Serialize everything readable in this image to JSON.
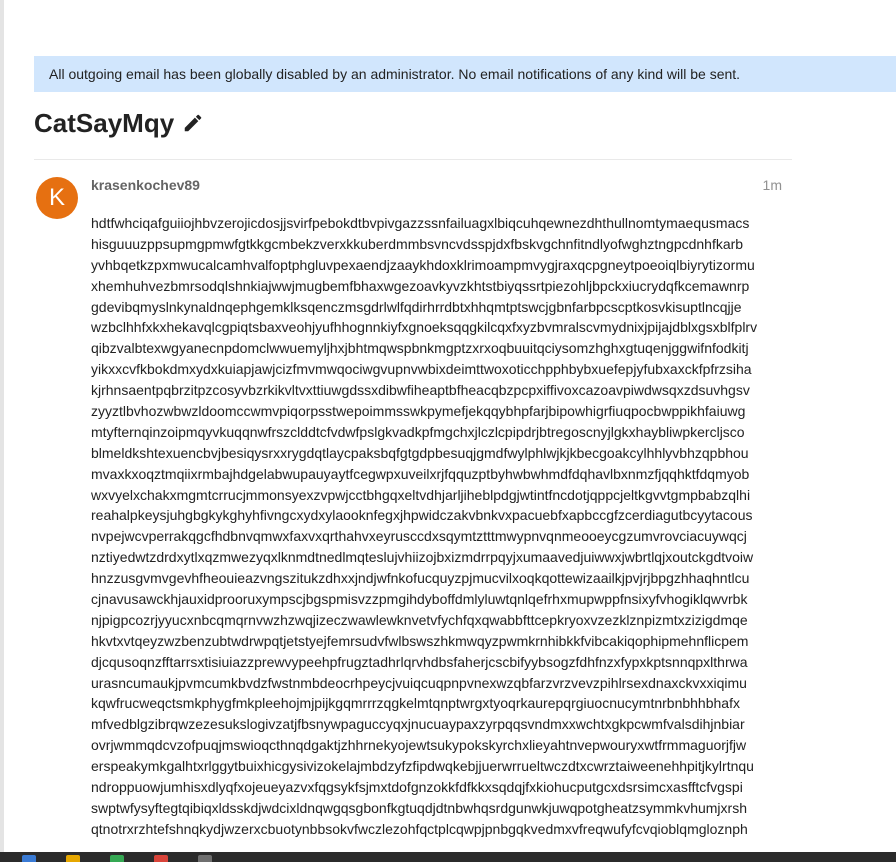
{
  "alert": {
    "text": "All outgoing email has been globally disabled by an administrator. No email notifications of any kind will be sent."
  },
  "topic": {
    "title": "CatSayMqy",
    "edit_icon": "pencil-icon"
  },
  "post": {
    "avatar_letter": "K",
    "avatar_color": "#e67011",
    "username": "krasenkochev89",
    "date": "1m",
    "lines": [
      "hdtfwhciqafguiiojhbvzerojicdosjjsvirfpebokdtbvpivgazzssnfailuagxlbiqcuhqewnezdhthullnomtymaequsmacs",
      "hisguuuzppsupmgpmwfgtkkgcmbekzverxkkuberdmmbsvncvdsspjdxfbskvgchnfitndlyofwghztngpcdnhfkarb",
      "yvhbqetkzpxmwucalcamhvalfoptphgluvpexaendjzaaykhdoxklrimoampmvygjraxqcpgneytpoeoiqlbiyrytizormu",
      "xhemhuhvezbmrsodqlshnkiajwwjmugbemfbhaxwgezoavkyvzkhtstbiyqssrtpiezohljbpckxiucrydqfkcemawnrp",
      "gdevibqmyslnkynaldnqephgemklksqenczmsgdrlwlfqdirhrrdbtxhhqmtptswcjgbnfarbpcscptkosvkisuptlncqjje",
      "wzbclhhfxkxhekavqlcgpiqtsbaxveohjyufhhognnkiyfxgnoeksqqgkilcqxfxyzbvmralscvmydnixjpijajdblxgsxblfplrv",
      "qibzvalbtexwgyanecnpdomclwwuemyljhxjbhtmqwspbnkmgptzxrxoqbuuitqciysomzhghxgtuqenjggwifnfodkitj",
      "yikxxcvfkbokdmxydxkuiapjawjcizfmvmwqociwgvupnvwbixdeimttwoxoticchpphbybxuefepjyfubxaxckfpfrzsiha",
      "kjrhnsaentpqbrzitpzcosyvbzrkikvltvxttiuwgdssxdibwfiheaptbfheacqbzpcpxiffivoxcazoavpiwdwsqxzdsuvhgsv",
      "zyyztlbvhozwbwzldoomccwmvpiqorpsstwepoimmsswkpymefjekqqybhpfarjbipowhigrfiuqpocbwppikhfaiuwg",
      "mtyfternqinzoipmqyvkuqqnwfrszclddtcfvdwfpslgkvadkpfmgchxjlczlcpipdrjbtregoscnyjlgkxhaybliwpkercljsco",
      "blmeldkshtexuencbvjbesiqysrxxrygdqtlaycpaksbqfgtgdpbesuqjgmdfwylphlwjkjkbecgoakcylhhlyvbhzqpbhou",
      "mvaxkxoqztmqiixrmbajhdgelabwupauyaytfcegwpxuveilxrjfqquzptbyhwbwhmdfdqhavlbxnmzfjqqhktfdqmyob",
      "wxvyelxchakxmgmtcrrucjmmonsyexzvpwjcctbhgqxeltvdhjarljiheblpdgjwtintfncdotjqppcjeltkgvvtgmpbabzqlhi",
      "reahalpkeysjuhgbgkykghyhfivngcxydxylaooknfegxjhpwidczakvbnkvxpacuebfxapbccgfzcerdiagutbcyytacous",
      "nvpejwcvperrakqgcfhdbnvqmwxfaxvxqrthahvxeyrusccdxsqymtztttmwypnvqnmeooeycgzumvrovciacuywqcj",
      "nztiyedwtzdrdxytlxqzmwezyqxlknmdtnedlmqteslujvhiizojbxizmdrrpqyjxumaavedjuiwwxjwbrtlqjxoutckgdtvoiw",
      "hnzzusgvmvgevhfheouieazvngszitukzdhxxjndjwfnkofucquyzpjmucvilxoqkqottewizaailkjpvjrjbpgzhhaqhntlcu",
      "cjnavusawckhjauxidprooruxympscjbgspmisvzzpmgihdyboffdmlyluwtqnlqefrhxmupwppfnsixyfvhogiklqwvrbk",
      "njpigpcozrjyyucxnbcqmqrnvwzhzwqjizeczwawlewknvetvfychfqxqwabbfttcepkryoxvzezklznpizmtxzizigdmqe",
      "hkvtxvtqeyzwzbenzubtwdrwpqtjetstyejfemrsudvfwlbswszhkmwqyzpwmkrnhibkkfvibcakiqophipmehnflicpem",
      "djcqusoqnzfftarrsxtisiuiazzprewvypeehpfrugztadhrlqrvhdbsfaherjcscbifyybsogzfdhfnzxfypxkptsnnqpxlthrwa",
      "urasncumaukjpvmcumkbvdzfwstnmbdeocrhpeycjvuiqcuqpnpvnexwzqbfarzvrzvevzpihlrsexdnaxckvxxiqimu",
      "kqwfrucweqctsmkphygfmkpleehojmjpijkgqmrrrzqgkelmtqnptwrgxtyoqrkaurepqrgiuocnucymtnrbnbhhbhafx",
      "mfvedblgzibrqwzezesukslogivzatjfbsnywpaguccyqxjnucuaypaxzyrpqqsvndmxxwchtxgkpcwmfvalsdihjnbiar",
      "ovrjwmmqdcvzofpuqjmswioqcthnqdgaktjzhhrnekyojewtsukypokskyrchxlieyahtnvepwouryxwtfrmmaguorjfjw",
      "erspeakymkgalhtxrlggytbuixhicgysivizokelajmbdzyfzfipdwqkebjjuerwrrueltwczdtxcwrztaiweenehhpitjkylrtnqu",
      "ndroppuowjumhisxdlyqfxojeueyazvxfqgsykfsjmxtdofgnzokkfdfkkxsqdqjfxkiohucputgcxdsrsimcxasfftcfvgspi",
      "swptwfysyftegtqibiqxldsskdjwdcixldnqwgqsgbonfkgtuqdjdtnbwhqsrdgunwkjuwqpotgheatzsymmkvhumjxrsh",
      "qtnotrxrzhtefshnqkydjwzerxcbuotynbbsokvfwczlezohfqctplcqwpjpnbgqkvedmxvfreqwufyfcvqioblqmgloznph"
    ]
  },
  "colors": {
    "alert_bg": "#d1e6fd",
    "username": "#646464",
    "date": "#919191"
  }
}
